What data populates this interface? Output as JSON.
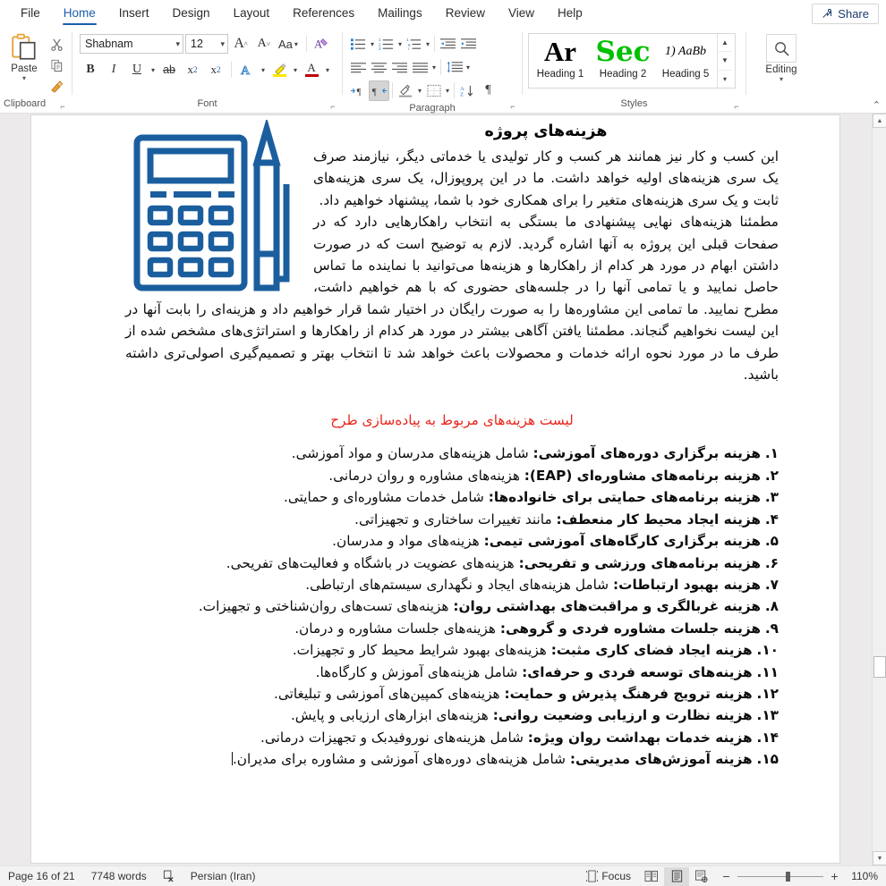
{
  "tabs": [
    {
      "label": "File",
      "active": false
    },
    {
      "label": "Home",
      "active": true
    },
    {
      "label": "Insert",
      "active": false
    },
    {
      "label": "Design",
      "active": false
    },
    {
      "label": "Layout",
      "active": false
    },
    {
      "label": "References",
      "active": false
    },
    {
      "label": "Mailings",
      "active": false
    },
    {
      "label": "Review",
      "active": false
    },
    {
      "label": "View",
      "active": false
    },
    {
      "label": "Help",
      "active": false
    }
  ],
  "share": {
    "label": "Share",
    "icon": "share-person-icon"
  },
  "ribbon": {
    "clipboard": {
      "group_label": "Clipboard",
      "paste_label": "Paste",
      "cut_icon": "scissors-icon",
      "copy_icon": "copy-icon",
      "format_painter_icon": "format-painter-icon",
      "dialog_launcher": "⌐"
    },
    "font": {
      "group_label": "Font",
      "font_name": "Shabnam",
      "font_size": "12",
      "grow_font": "A",
      "shrink_font": "A",
      "change_case": "Aa",
      "clear_formatting_icon": "clear-formatting-icon",
      "bold": "B",
      "italic": "I",
      "underline": "U",
      "strikethrough": "ab",
      "subscript": "x",
      "superscript": "x",
      "text_effects": "A",
      "highlight_icon": "highlight-icon",
      "font_color": "A",
      "highlight_color": "#ffe600",
      "font_color_swatch": "#c00000"
    },
    "paragraph": {
      "group_label": "Paragraph",
      "bullets_icon": "bullets-icon",
      "numbering_icon": "numbering-icon",
      "multilevel_icon": "multilevel-list-icon",
      "decrease_indent_icon": "decrease-indent-icon",
      "increase_indent_icon": "increase-indent-icon",
      "align_left_icon": "align-left-icon",
      "align_center_icon": "align-center-icon",
      "align_right_icon": "align-right-icon",
      "justify_icon": "justify-icon",
      "line_spacing_icon": "line-spacing-icon",
      "ltr_icon": "left-to-right-icon",
      "rtl_icon": "right-to-left-icon",
      "rtl_active": true,
      "shading_icon": "shading-icon",
      "borders_icon": "borders-icon",
      "sort_icon": "sort-az-icon",
      "show_marks_icon": "pilcrow-icon"
    },
    "styles": {
      "group_label": "Styles",
      "items": [
        {
          "preview": "Ar",
          "name": "Heading 1",
          "color": "#000000",
          "style": "serif-bold"
        },
        {
          "preview": "Sec",
          "name": "Heading 2",
          "color": "#00c000",
          "style": "serif-bold"
        },
        {
          "preview": "1)  AaBb",
          "name": "Heading 5",
          "color": "#000000",
          "style": "serif-italic"
        }
      ]
    },
    "editing": {
      "group_label": "",
      "label": "Editing",
      "icon": "magnifier-icon"
    },
    "collapse_icon": "chevron-up-icon"
  },
  "document": {
    "title": "هزینه‌های پروژه",
    "image_alt": "calculator-and-pencil-illustration",
    "image_color": "#1B5E9E",
    "paragraph1": "این کسب و کار نیز همانند هر کسب و کار تولیدی یا خدماتی دیگر، نیازمند صرف یک سری هزینه‌های اولیه خواهد داشت. ما در این پروپوزال، یک سری هزینه‌های ثابت و یک سری هزینه‌های متغیر را برای همکاری خود با شما، پیشنهاد خواهیم داد.",
    "paragraph2": "مطمئنا هزینه‌های نهایی پیشنهادی ما بستگی به انتخاب راهکارهایی دارد که در صفحات قبلی این پروژه به آنها اشاره گردید. لازم به توضیح است که در صورت داشتن ابهام در مورد هر کدام از راهکارها و هزینه‌ها می‌توانید با نماینده ما تماس حاصل نمایید و یا تمامی آنها را در جلسه‌های حضوری که با هم خواهیم داشت، مطرح نمایید. ما تمامی این مشاوره‌ها را به صورت رایگان در اختیار شما قرار خواهیم داد و هزینه‌ای را بابت آنها در این لیست نخواهیم گنجاند. مطمئنا یافتن آگاهی بیشتر در مورد هر کدام از راهکارها و استراتژی‌های مشخص شده از طرف ما در مورد نحوه ارائه خدمات و محصولات باعث خواهد شد تا انتخاب بهتر و تصمیم‌گیری اصولی‌تری داشته باشید.",
    "red_heading": "لیست هزینه‌های مربوط به پیاده‌سازی طرح",
    "red_color": "#E8281D",
    "list": [
      {
        "num": "۱.",
        "bold": "هزینه برگزاری دوره‌های آموزشی:",
        "rest": " شامل هزینه‌های مدرسان و مواد آموزشی."
      },
      {
        "num": "۲.",
        "bold": "هزینه برنامه‌های مشاوره‌ای (EAP):",
        "rest": " هزینه‌های مشاوره و روان درمانی."
      },
      {
        "num": "۳.",
        "bold": "هزینه برنامه‌های حمایتی برای خانواده‌ها:",
        "rest": " شامل خدمات مشاوره‌ای و حمایتی."
      },
      {
        "num": "۴.",
        "bold": "هزینه ایجاد محیط کار منعطف:",
        "rest": " مانند تغییرات ساختاری و تجهیزاتی."
      },
      {
        "num": "۵.",
        "bold": "هزینه برگزاری کارگاه‌های آموزشی تیمی:",
        "rest": " هزینه‌های مواد و مدرسان."
      },
      {
        "num": "۶.",
        "bold": "هزینه برنامه‌های ورزشی و تفریحی:",
        "rest": " هزینه‌های عضویت در باشگاه و فعالیت‌های تفریحی."
      },
      {
        "num": "۷.",
        "bold": "هزینه بهبود ارتباطات:",
        "rest": " شامل هزینه‌های ایجاد و نگهداری سیستم‌های ارتباطی."
      },
      {
        "num": "۸.",
        "bold": "هزینه غربالگری و مراقبت‌های بهداشتی روان:",
        "rest": " هزینه‌های تست‌های روان‌شناختی و تجهیزات."
      },
      {
        "num": "۹.",
        "bold": "هزینه جلسات مشاوره فردی و گروهی:",
        "rest": " هزینه‌های جلسات مشاوره و درمان."
      },
      {
        "num": "۱۰.",
        "bold": "هزینه ایجاد فضای کاری مثبت:",
        "rest": " هزینه‌های بهبود شرایط محیط کار و تجهیزات."
      },
      {
        "num": "۱۱.",
        "bold": "هزینه‌های توسعه فردی و حرفه‌ای:",
        "rest": " شامل هزینه‌های آموزش و کارگاه‌ها."
      },
      {
        "num": "۱۲.",
        "bold": "هزینه ترویج فرهنگ پذیرش و حمایت:",
        "rest": " هزینه‌های کمپین‌های آموزشی و تبلیغاتی."
      },
      {
        "num": "۱۳.",
        "bold": "هزینه نظارت و ارزیابی وضعیت روانی:",
        "rest": " هزینه‌های ابزارهای ارزیابی و پایش."
      },
      {
        "num": "۱۴.",
        "bold": "هزینه خدمات بهداشت روان ویژه:",
        "rest": " شامل هزینه‌های نوروفیدبک و تجهیزات درمانی."
      },
      {
        "num": "۱۵.",
        "bold": "هزینه آموزش‌های مدیریتی:",
        "rest": " شامل هزینه‌های دوره‌های آموزشی و مشاوره برای مدیران."
      }
    ]
  },
  "statusbar": {
    "page": "Page 16 of 21",
    "words": "7748 words",
    "proofing_icon": "proofing-errors-icon",
    "language": "Persian (Iran)",
    "focus": "Focus",
    "focus_icon": "focus-mode-icon",
    "view_read_icon": "read-mode-icon",
    "view_print_icon": "print-layout-icon",
    "view_web_icon": "web-layout-icon",
    "active_view": "print-layout",
    "zoom_out": "−",
    "zoom_in": "+",
    "zoom_level": "110%"
  }
}
